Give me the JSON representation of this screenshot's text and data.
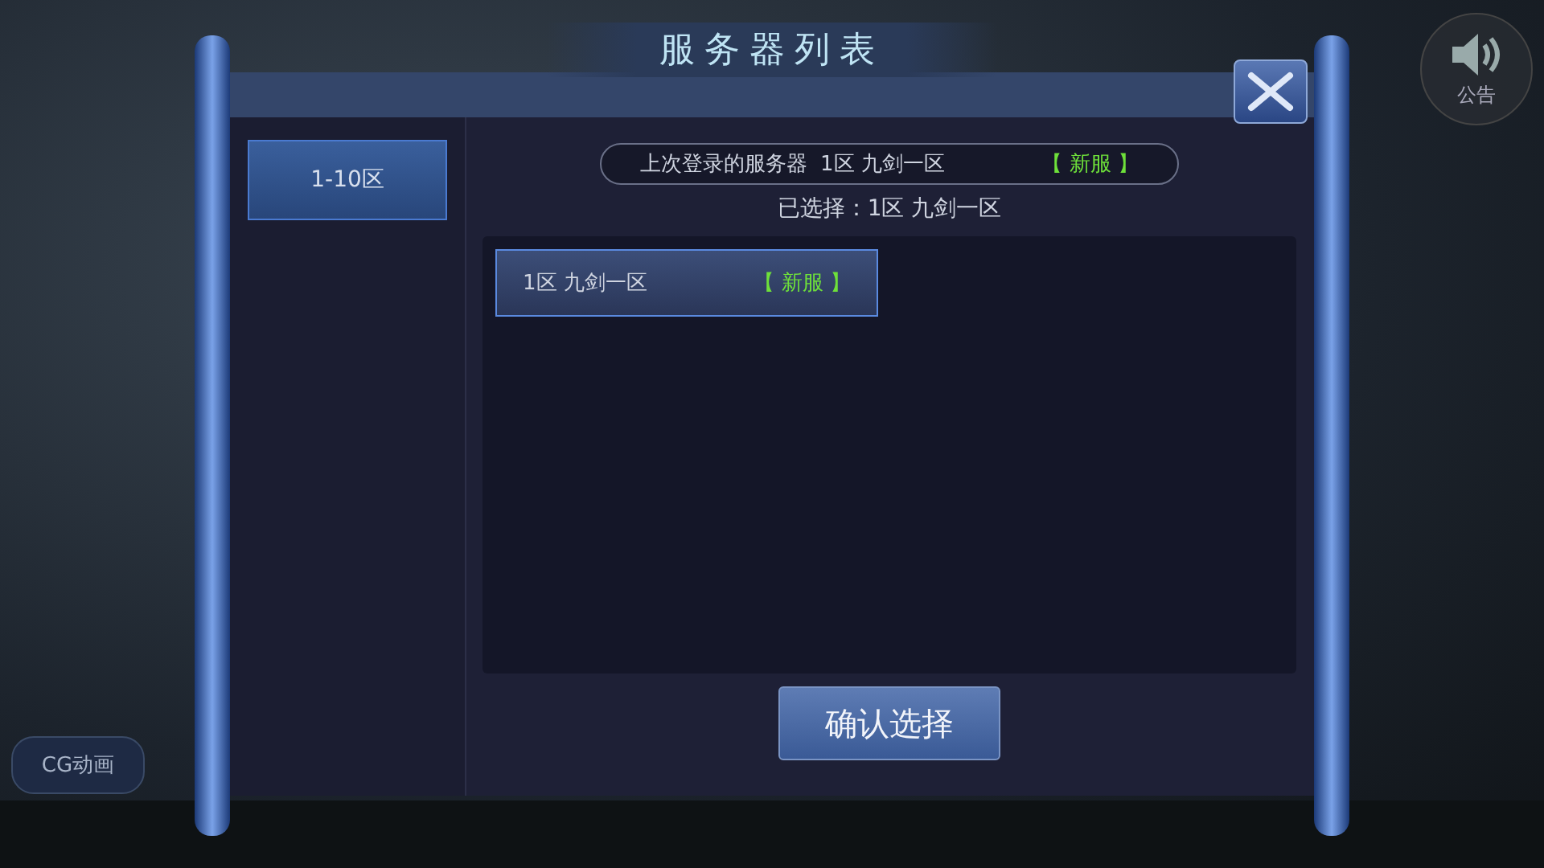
{
  "window": {
    "title": "服务器列表"
  },
  "announcement": {
    "label": "公告"
  },
  "cg_button": {
    "label": "CG动画"
  },
  "zones": [
    {
      "label": "1-10区",
      "selected": true
    }
  ],
  "last_login": {
    "label": "上次登录的服务器",
    "server": "1区 九剑一区",
    "tag": "【 新服 】"
  },
  "selected_text": "已选择：1区 九剑一区",
  "servers": [
    {
      "name": "1区 九剑一区",
      "tag": "【 新服 】",
      "selected": true
    }
  ],
  "confirm_button": {
    "label": "确认选择"
  }
}
